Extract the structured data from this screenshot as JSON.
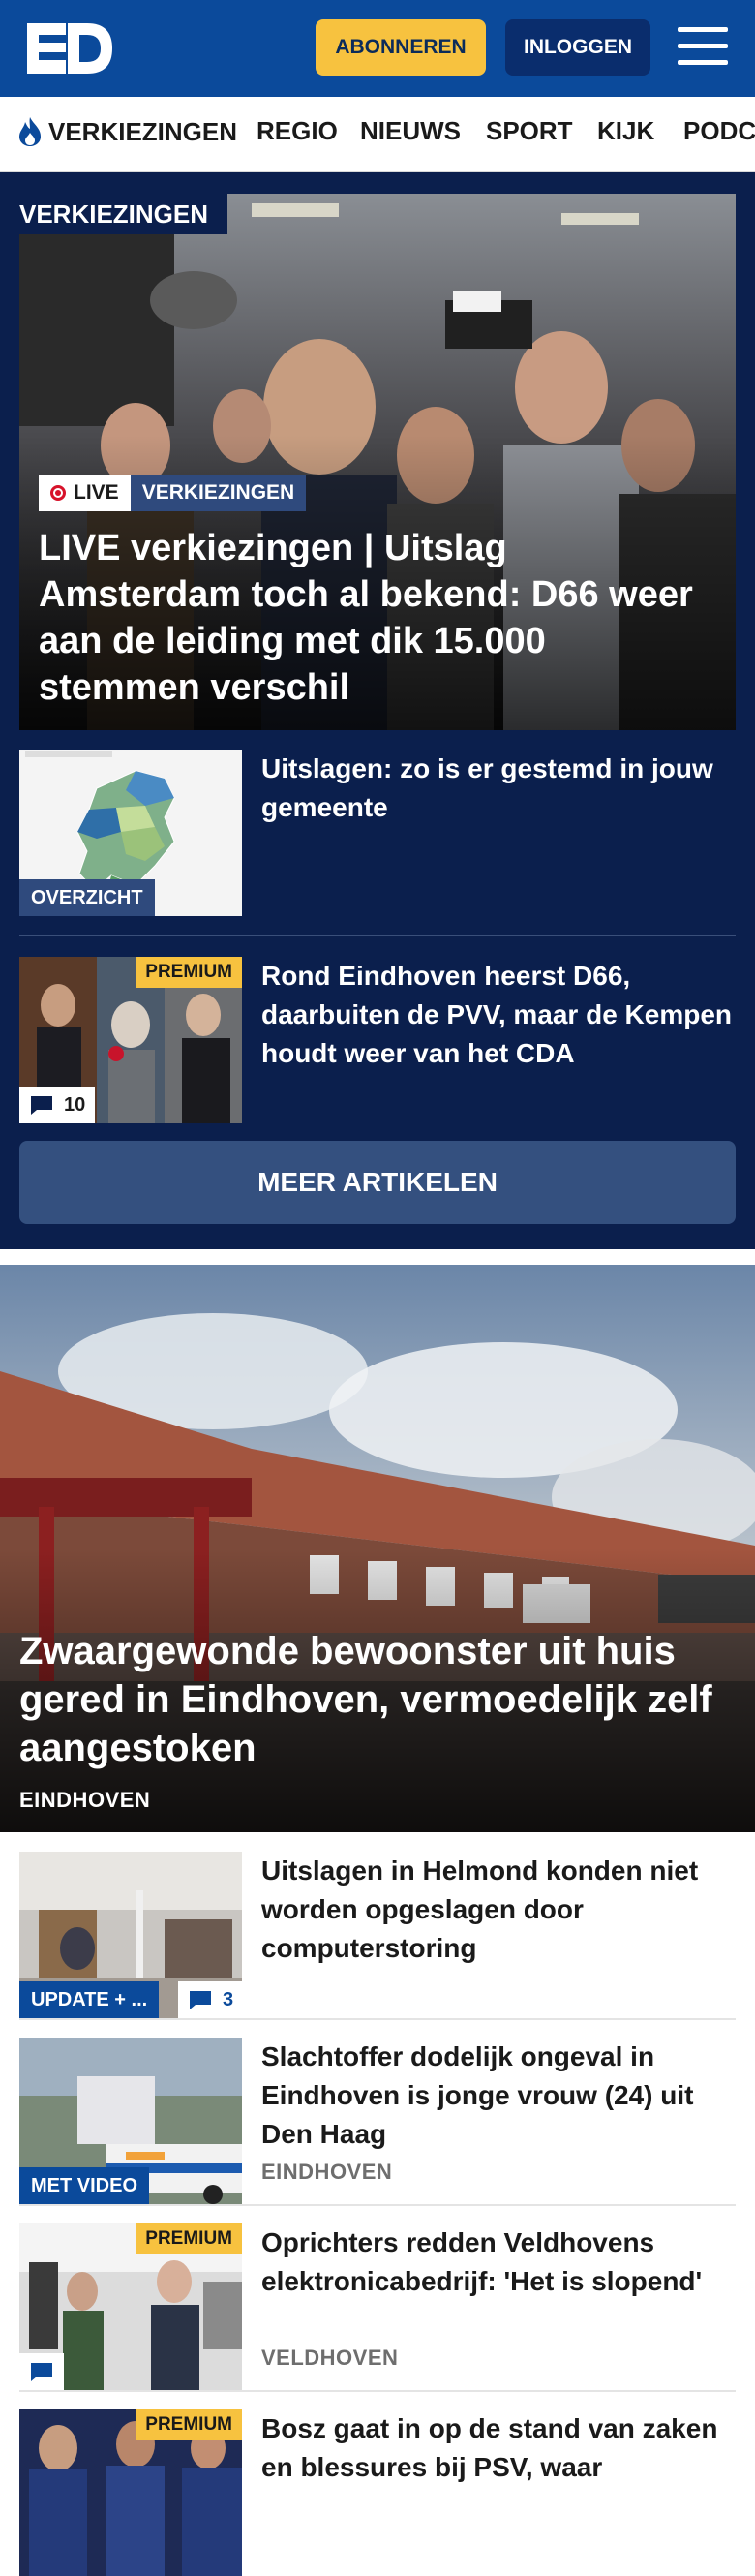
{
  "header": {
    "logo": "ED",
    "subscribe_label": "ABONNEREN",
    "login_label": "INLOGGEN"
  },
  "nav": {
    "items": [
      "VERKIEZINGEN",
      "REGIO",
      "NIEUWS",
      "SPORT",
      "KIJK",
      "PODC"
    ]
  },
  "elections": {
    "section_label": "VERKIEZINGEN",
    "hero": {
      "live_label": "LIVE",
      "category": "VERKIEZINGEN",
      "title": "LIVE verkiezingen | Uitslag Amsterdam toch al bekend: D66 weer aan de leiding met dik 15.000 stemmen verschil"
    },
    "items": [
      {
        "thumb_label": "OVERZICHT",
        "title": "Uitslagen: zo is er gestemd in jouw gemeente"
      },
      {
        "premium": "PREMIUM",
        "comments": "10",
        "title": "Rond Eindhoven heerst D66, daarbuiten de PVV, maar de Kempen houdt weer van het CDA"
      }
    ],
    "more_label": "MEER ARTIKELEN"
  },
  "main_hero": {
    "title": "Zwaargewonde bewoonster uit huis gered in Eindhoven, vermoedelijk zelf aangestoken",
    "location": "EINDHOVEN"
  },
  "news": [
    {
      "label": "UPDATE + ...",
      "comments": "3",
      "title": "Uitslagen in Helmond konden niet worden opgeslagen door computerstoring",
      "location": ""
    },
    {
      "label": "MET VIDEO",
      "title": "Slachtoffer dodelijk ongeval in Eindhoven is jonge vrouw (24) uit Den Haag",
      "location": "EINDHOVEN"
    },
    {
      "premium": "PREMIUM",
      "title": "Oprichters redden Veldhovens elektronicabedrijf: 'Het is slopend'",
      "location": "VELDHOVEN"
    },
    {
      "premium": "PREMIUM",
      "title": "Bosz gaat in op de stand van zaken en blessures bij PSV, waar"
    }
  ],
  "colors": {
    "brand_blue": "#0b4a9b",
    "dark_navy": "#0b1f4d",
    "premium_yellow": "#f7c23f",
    "live_red": "#d7132b"
  }
}
